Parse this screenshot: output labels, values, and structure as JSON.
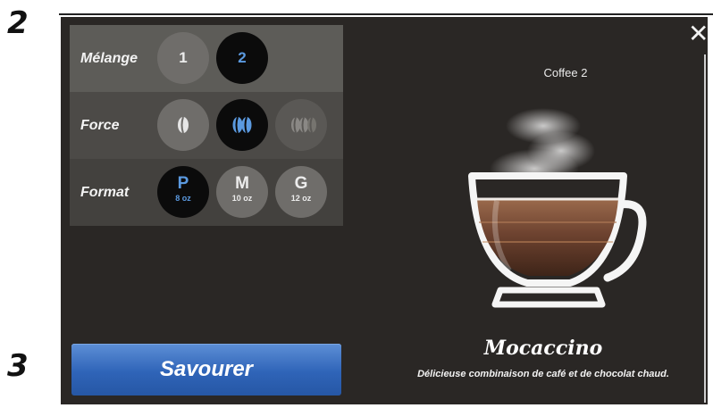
{
  "steps": {
    "step_a": "2",
    "step_b": "3"
  },
  "screen": {
    "close_glyph": "✕",
    "brand": "Coffee 2",
    "options": {
      "melange": {
        "label": "Mélange",
        "choices": [
          "1",
          "2"
        ],
        "selected": "2"
      },
      "force": {
        "label": "Force",
        "levels": 3,
        "selected_level": 2
      },
      "format": {
        "label": "Format",
        "choices": [
          {
            "letter": "P",
            "size": "8 oz"
          },
          {
            "letter": "M",
            "size": "10 oz"
          },
          {
            "letter": "G",
            "size": "12 oz"
          }
        ],
        "selected": "P"
      }
    },
    "drink": {
      "name": "Mocaccino",
      "description": "Délicieuse combinaison de café et de chocolat chaud."
    },
    "action_label": "Savourer",
    "colors": {
      "accent": "#5b9ae0",
      "button": "#2f64b8",
      "background": "#2a2725"
    }
  }
}
